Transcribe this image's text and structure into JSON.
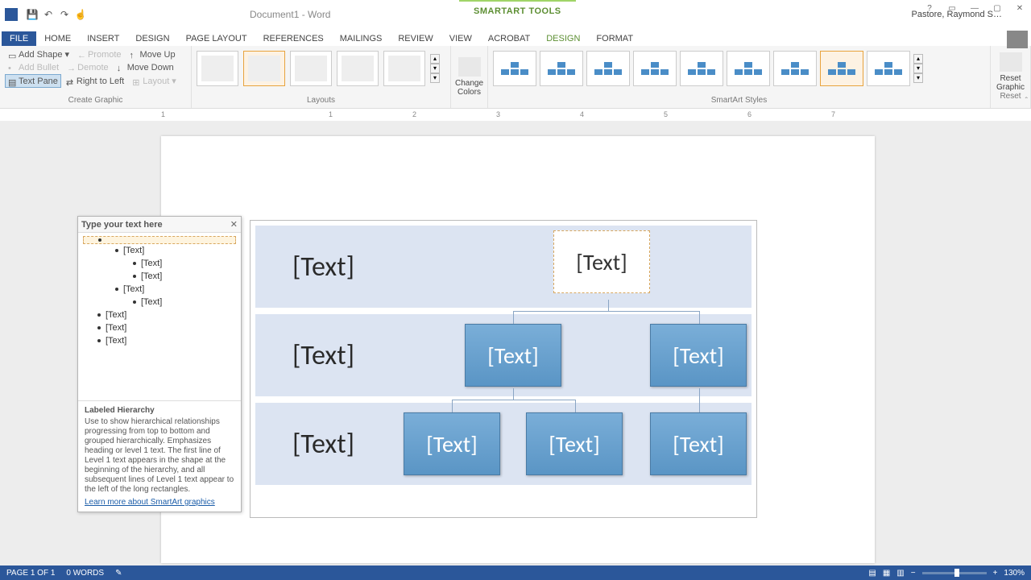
{
  "titlebar": {
    "doc_title": "Document1 - Word",
    "tools_label": "SMARTART TOOLS",
    "user_name": "Pastore, Raymond S…"
  },
  "tabs": {
    "file": "FILE",
    "home": "HOME",
    "insert": "INSERT",
    "design_main": "DESIGN",
    "page_layout": "PAGE LAYOUT",
    "references": "REFERENCES",
    "mailings": "MAILINGS",
    "review": "REVIEW",
    "view": "VIEW",
    "acrobat": "ACROBAT",
    "design": "DESIGN",
    "format": "FORMAT"
  },
  "ribbon": {
    "create_graphic": {
      "add_shape": "Add Shape",
      "add_bullet": "Add Bullet",
      "text_pane": "Text Pane",
      "promote": "Promote",
      "demote": "Demote",
      "right_to_left": "Right to Left",
      "move_up": "Move Up",
      "move_down": "Move Down",
      "layout": "Layout",
      "label": "Create Graphic"
    },
    "layouts_label": "Layouts",
    "change_colors": "Change Colors",
    "styles_label": "SmartArt Styles",
    "reset_graphic": "Reset Graphic",
    "reset_label": "Reset"
  },
  "ruler": {
    "ticks": [
      "1",
      "1",
      "2",
      "3",
      "4",
      "5",
      "6",
      "7"
    ]
  },
  "textpane": {
    "title": "Type your text here",
    "items": [
      {
        "level": 1,
        "text": "",
        "active": true
      },
      {
        "level": 2,
        "text": "[Text]"
      },
      {
        "level": 3,
        "text": "[Text]"
      },
      {
        "level": 3,
        "text": "[Text]"
      },
      {
        "level": 2,
        "text": "[Text]"
      },
      {
        "level": 3,
        "text": "[Text]"
      },
      {
        "level": 1,
        "text": "[Text]"
      },
      {
        "level": 1,
        "text": "[Text]"
      },
      {
        "level": 1,
        "text": "[Text]"
      }
    ],
    "info_title": "Labeled Hierarchy",
    "info_desc": "Use to show hierarchical relationships progressing from top to bottom and grouped hierarchically. Emphasizes heading or level 1 text. The first line of Level 1 text appears in the shape at the beginning of the hierarchy, and all subsequent lines of Level 1 text appear to the left of the long rectangles.",
    "info_link": "Learn more about SmartArt graphics"
  },
  "smartart": {
    "row1_label": "[Text]",
    "row1_top": "[Text]",
    "row2_label": "[Text]",
    "row2_n1": "[Text]",
    "row2_n2": "[Text]",
    "row3_label": "[Text]",
    "row3_n1": "[Text]",
    "row3_n2": "[Text]",
    "row3_n3": "[Text]"
  },
  "statusbar": {
    "page": "PAGE 1 OF 1",
    "words": "0 WORDS",
    "zoom": "130%"
  }
}
